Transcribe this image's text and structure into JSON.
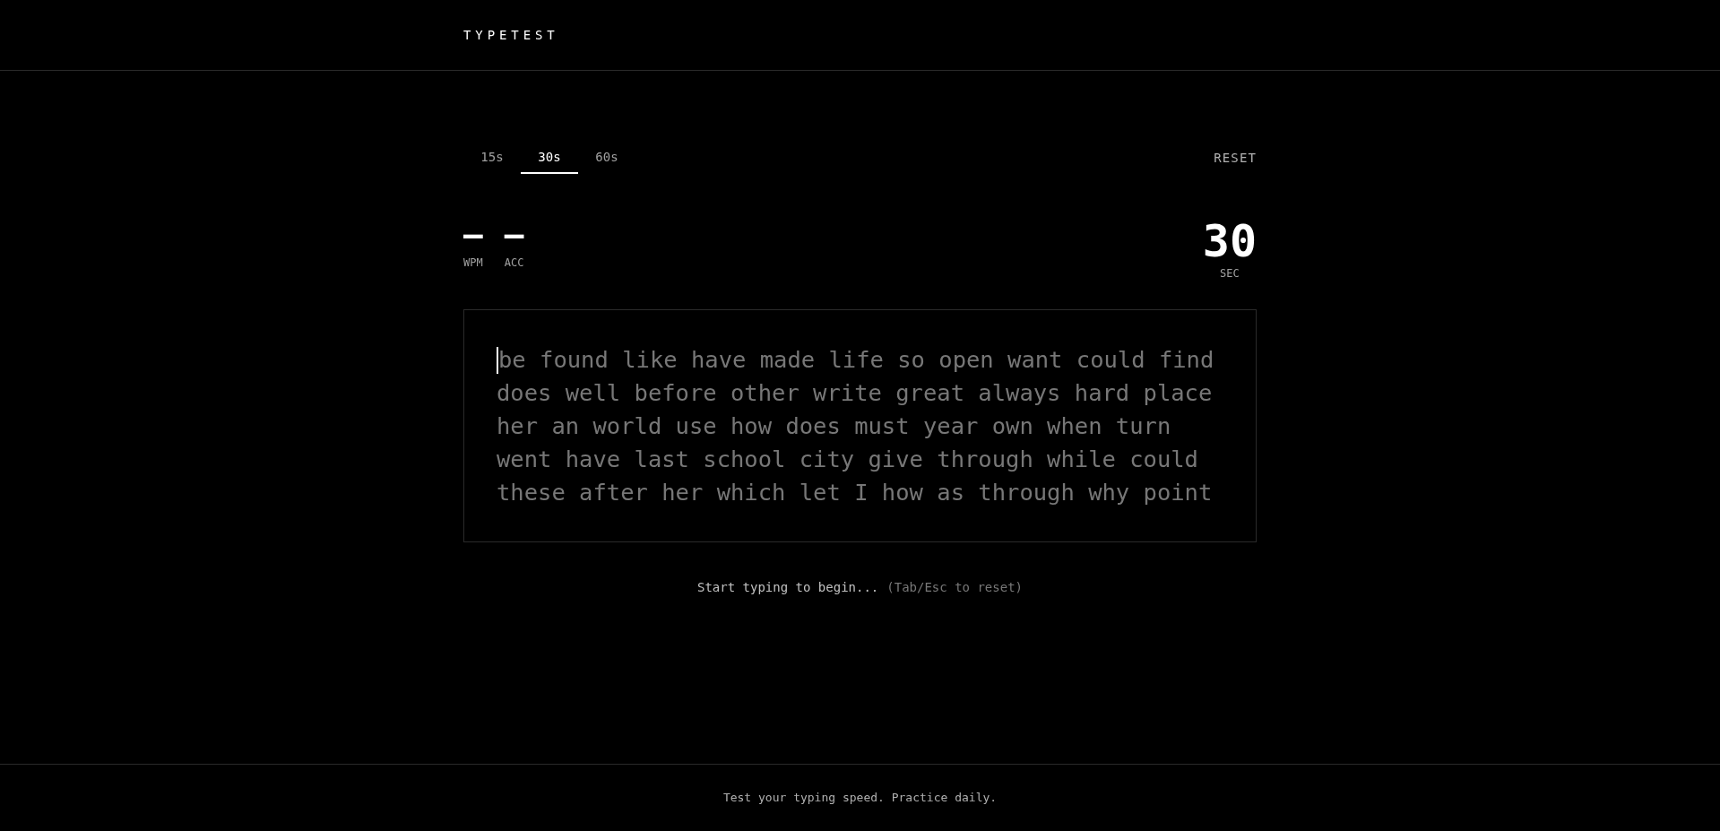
{
  "header": {
    "logo": "TYPETEST"
  },
  "durations": [
    {
      "label": "15s",
      "selected": false
    },
    {
      "label": "30s",
      "selected": true
    },
    {
      "label": "60s",
      "selected": false
    }
  ],
  "reset": "RESET",
  "stats": [
    {
      "value": "—",
      "label": "WPM"
    },
    {
      "value": "—",
      "label": "ACC"
    }
  ],
  "timer": {
    "value": "30",
    "label": "SEC"
  },
  "text_lines": [
    "be found like have made life so open want could find",
    "does well before other write great always hard place",
    "her an world use how does must year own when turn",
    "went have last school city give through while could",
    "these after her which let I how as through why point"
  ],
  "hint": {
    "text": "Start typing to begin...",
    "note": "(Tab/Esc to reset)"
  },
  "footer": "Test your typing speed. Practice daily."
}
